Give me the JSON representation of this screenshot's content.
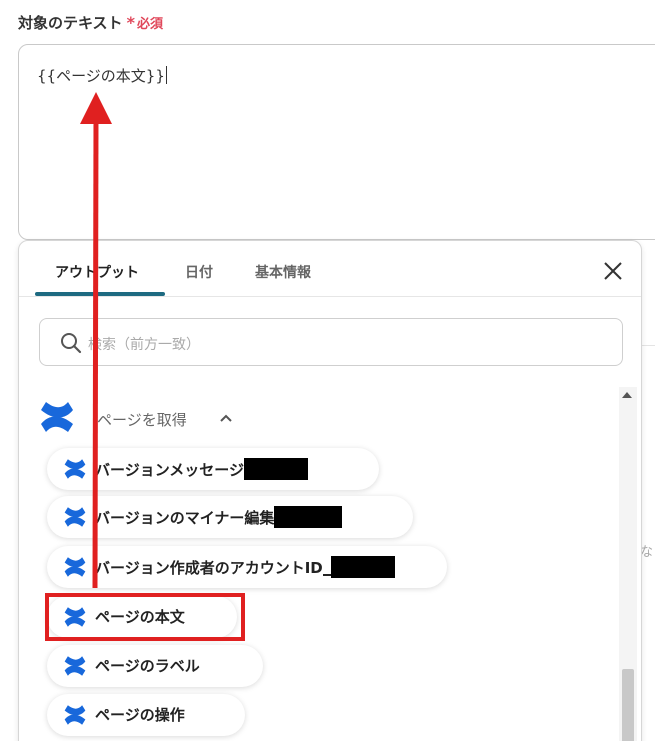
{
  "field": {
    "label": "対象のテキスト",
    "required_star": "*",
    "required_text": "必須",
    "value": "{{ページの本文}}"
  },
  "panel": {
    "tabs": [
      {
        "label": "アウトプット",
        "active": true
      },
      {
        "label": "日付",
        "active": false
      },
      {
        "label": "基本情報",
        "active": false
      }
    ],
    "search_placeholder": "検索（前方一致）",
    "group": {
      "title": "ページを取得",
      "icon": "confluence-logo",
      "expanded": true
    },
    "items": [
      {
        "label": "バージョンメッセージ",
        "redacted": true
      },
      {
        "label": "バージョンのマイナー編集",
        "redacted": true
      },
      {
        "label": "バージョン作成者のアカウントID",
        "redacted": true
      },
      {
        "label": "ページの本文",
        "redacted": false,
        "highlighted": true
      },
      {
        "label": "ページのラベル",
        "redacted": false
      },
      {
        "label": "ページの操作",
        "redacted": false
      }
    ]
  },
  "background": {
    "edge_text": "な"
  },
  "colors": {
    "required": "#e0475a",
    "tab_underline": "#1d6a81",
    "annotation_red": "#e02020",
    "confluence_blue": "#1868db"
  }
}
